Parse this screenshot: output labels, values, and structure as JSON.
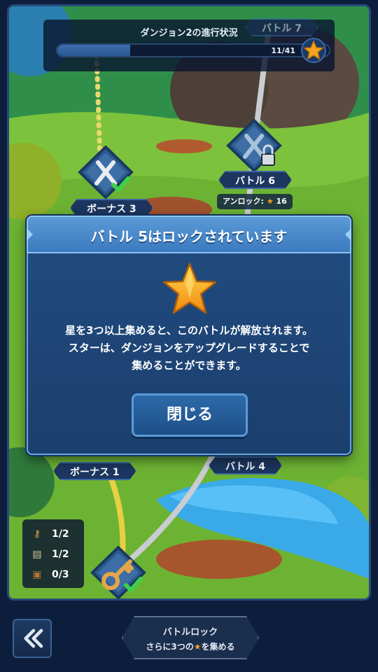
{
  "progress": {
    "title": "ダンジョン2の進行状況",
    "count": "11/41",
    "fraction": 0.268
  },
  "nodes": {
    "battle7": "バトル 7",
    "battle6": "バトル 6",
    "bonus3": "ボーナス 3",
    "bonus1": "ボーナス 1",
    "battle4": "バトル 4"
  },
  "unlock_requirement": {
    "prefix": "アンロック:",
    "star_glyph": "★",
    "stars": "16"
  },
  "items": [
    {
      "icon": "key-icon",
      "value": "1/2"
    },
    {
      "icon": "scroll-icon",
      "value": "1/2"
    },
    {
      "icon": "chest-icon",
      "value": "0/3"
    }
  ],
  "modal": {
    "title": "バトル 5はロックされています",
    "message_lines": [
      "星を3つ以上集めると、このバトルが解放されます。",
      "スターは、ダンジョンをアップグレードすることで",
      "集めることができます。"
    ],
    "close_label": "閉じる"
  },
  "footer": {
    "lock_title": "バトルロック",
    "lock_prefix": "さらに3つの",
    "star_glyph": "★",
    "lock_suffix": "を集める"
  },
  "colors": {
    "accent": "#3c7abf",
    "star": "#f4a21f",
    "check": "#3fd04a",
    "panel": "#1c3660"
  }
}
